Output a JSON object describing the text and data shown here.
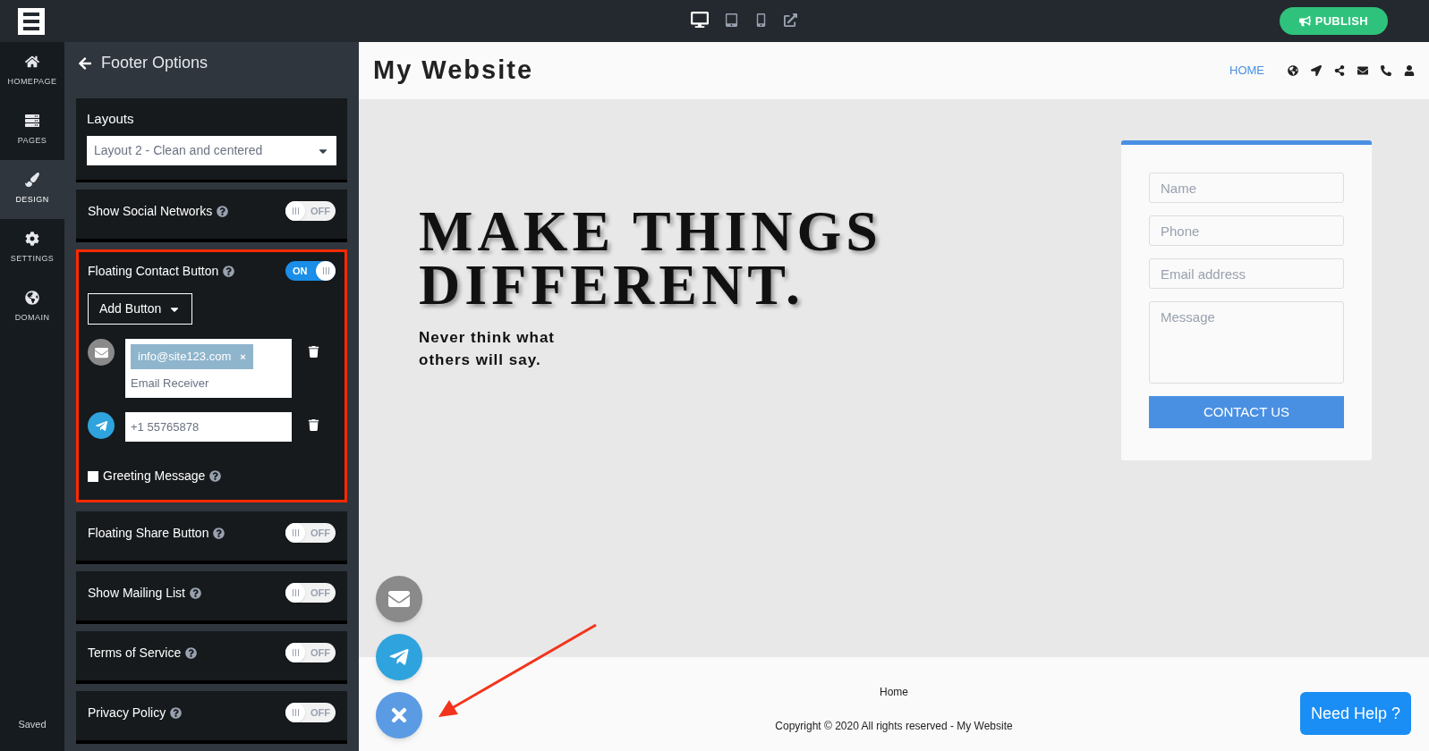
{
  "topbar": {
    "devices": [
      {
        "kind": "desktop",
        "selected": true
      },
      {
        "kind": "tablet",
        "selected": false
      },
      {
        "kind": "mobile",
        "selected": false
      },
      {
        "kind": "external",
        "selected": false
      }
    ],
    "publish": "PUBLISH"
  },
  "nav": [
    {
      "kind": "home",
      "label": "HOMEPAGE",
      "selected": false
    },
    {
      "kind": "pages",
      "label": "PAGES",
      "selected": false
    },
    {
      "kind": "design",
      "label": "DESIGN",
      "selected": true
    },
    {
      "kind": "settings",
      "label": "SETTINGS",
      "selected": false
    },
    {
      "kind": "domain",
      "label": "DOMAIN",
      "selected": false
    }
  ],
  "save_status": "Saved",
  "panel": {
    "title": "Footer Options",
    "layouts": {
      "label": "Layouts",
      "value": "Layout 2 - Clean and centered"
    },
    "options": [
      {
        "label": "Show Social Networks",
        "on": false,
        "toggle_text": "OFF",
        "highlighted": false
      },
      {
        "label": "Floating Contact Button",
        "on": true,
        "toggle_text": "ON",
        "highlighted": true,
        "add_button": "Add Button",
        "channels": [
          {
            "kind": "email",
            "tag": "info@site123.com",
            "tag_remove": "×",
            "placeholder": "Email Receiver"
          },
          {
            "kind": "telegram",
            "value": "+1 55765878"
          }
        ],
        "greeting": {
          "label": "Greeting Message",
          "checked": false
        }
      },
      {
        "label": "Floating Share Button",
        "on": false,
        "toggle_text": "OFF",
        "highlighted": false
      },
      {
        "label": "Show Mailing List",
        "on": false,
        "toggle_text": "OFF",
        "highlighted": false
      },
      {
        "label": "Terms of Service",
        "on": false,
        "toggle_text": "OFF",
        "highlighted": false
      },
      {
        "label": "Privacy Policy",
        "on": false,
        "toggle_text": "OFF",
        "highlighted": false
      }
    ]
  },
  "site": {
    "title": "My Website",
    "menu": [
      {
        "label": "HOME",
        "selected": true
      }
    ],
    "hero": {
      "title_lines": [
        "MAKE THINGS",
        "DIFFERENT."
      ],
      "subtitle_lines": [
        "Never think what",
        "others will say."
      ]
    },
    "form": {
      "fields": [
        {
          "kind": "input",
          "placeholder": "Name"
        },
        {
          "kind": "input",
          "placeholder": "Phone"
        },
        {
          "kind": "input",
          "placeholder": "Email address"
        },
        {
          "kind": "textarea",
          "placeholder": "Message"
        }
      ],
      "submit": "CONTACT US"
    },
    "floating_buttons": [
      {
        "kind": "email"
      },
      {
        "kind": "telegram"
      },
      {
        "kind": "close"
      }
    ],
    "footer": {
      "link": "Home",
      "copyright": "Copyright © 2020 All rights reserved - My Website"
    },
    "help": "Need Help ?"
  }
}
